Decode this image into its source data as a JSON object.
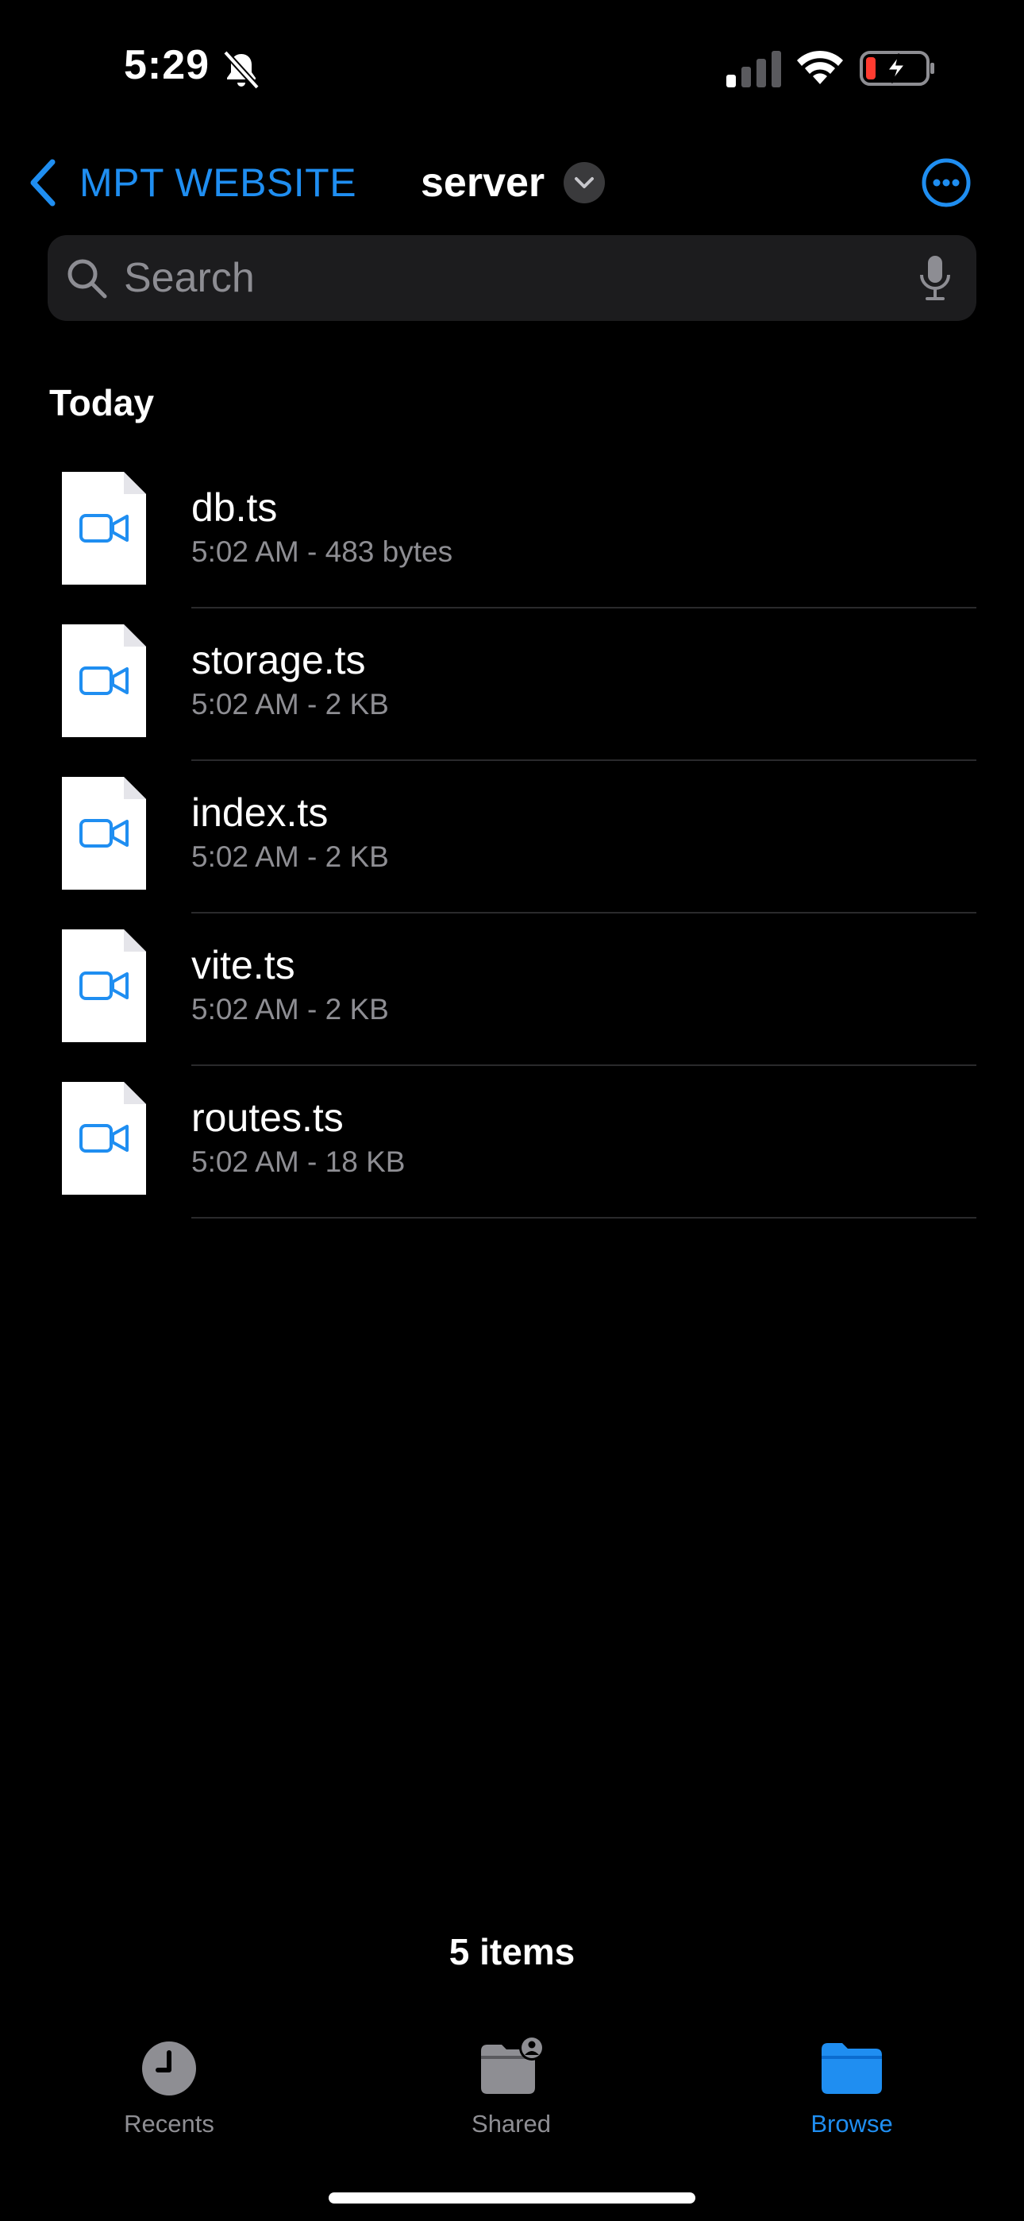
{
  "status_bar": {
    "time": "5:29"
  },
  "nav": {
    "back_label": "MPT WEBSITE",
    "title": "server"
  },
  "search": {
    "placeholder": "Search"
  },
  "section": {
    "header": "Today"
  },
  "files": [
    {
      "name": "db.ts",
      "meta": "5:02 AM - 483 bytes"
    },
    {
      "name": "storage.ts",
      "meta": "5:02 AM - 2 KB"
    },
    {
      "name": "index.ts",
      "meta": "5:02 AM - 2 KB"
    },
    {
      "name": "vite.ts",
      "meta": "5:02 AM - 2 KB"
    },
    {
      "name": "routes.ts",
      "meta": "5:02 AM - 18 KB"
    }
  ],
  "footer": {
    "item_count": "5 items"
  },
  "tabbar": {
    "tabs": [
      {
        "label": "Recents",
        "icon": "clock-icon",
        "active": false
      },
      {
        "label": "Shared",
        "icon": "shared-folder-icon",
        "active": false
      },
      {
        "label": "Browse",
        "icon": "folder-icon",
        "active": true
      }
    ]
  },
  "colors": {
    "accent": "#1f8ef1",
    "background": "#000000",
    "secondary_text": "#8e8e93",
    "battery_low": "#ff3b30"
  }
}
